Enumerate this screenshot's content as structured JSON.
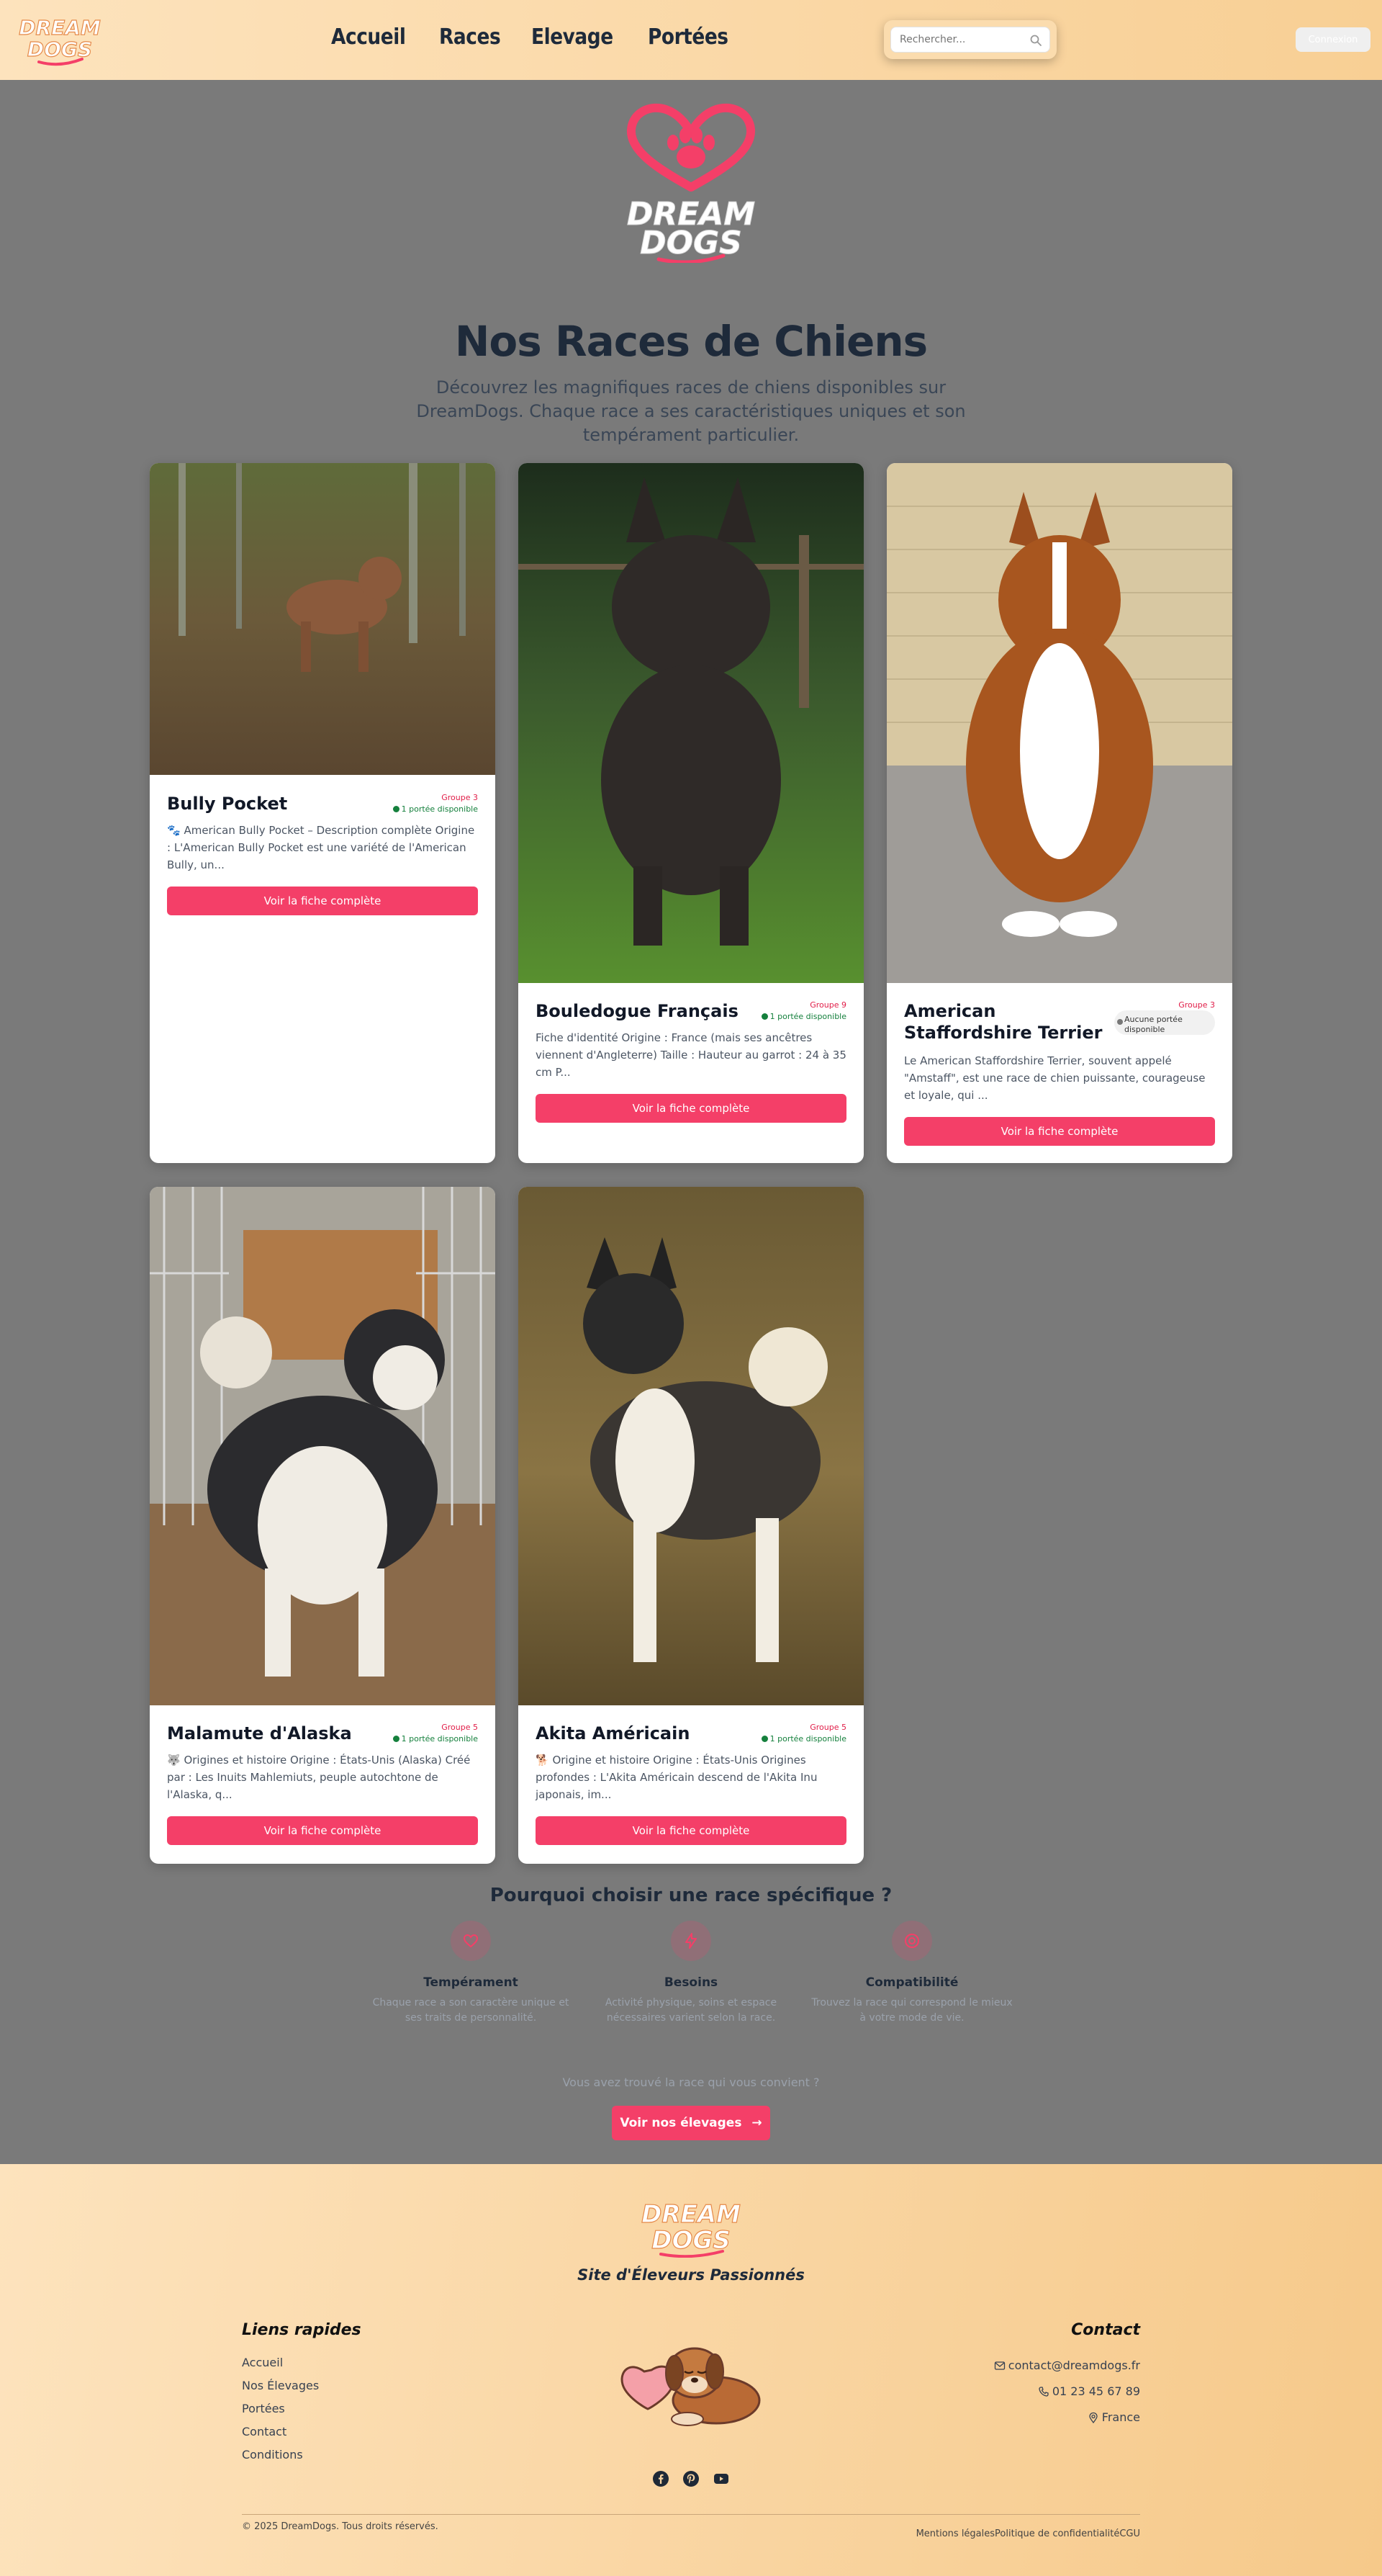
{
  "header": {
    "logo_line1": "DREAM",
    "logo_line2": "DOGS",
    "nav": [
      "Accueil",
      "Races",
      "Elevage",
      "Portées"
    ],
    "search_placeholder": "Rechercher...",
    "login_label": "Connexion"
  },
  "hero": {
    "logo_line1": "DREAM",
    "logo_line2": "DOGS",
    "title": "Nos Races de Chiens",
    "subtitle": "Découvrez les magnifiques races de chiens disponibles sur DreamDogs. Chaque race a ses caractéristiques uniques et son tempérament particulier."
  },
  "cards": [
    {
      "name": "Bully Pocket",
      "group": "Groupe 3",
      "availability": "1 portée disponible",
      "available": true,
      "description": "🐾 American Bully Pocket – Description complète Origine : L'American Bully Pocket est une variété de l'American Bully, un...",
      "cta": "Voir la fiche complète",
      "photo": "brown-dog-forest"
    },
    {
      "name": "Bouledogue Français",
      "group": "Groupe 9",
      "availability": "1 portée disponible",
      "available": true,
      "description": "Fiche d'identité Origine : France (mais ses ancêtres viennent d'Angleterre) Taille : Hauteur au garrot : 24 à 35 cm P...",
      "cta": "Voir la fiche complète",
      "photo": "black-french-bulldog"
    },
    {
      "name": "American Staffordshire Terrier",
      "group": "Groupe 3",
      "availability": "Aucune portée disponible",
      "available": false,
      "description": "Le American Staffordshire Terrier, souvent appelé \"Amstaff\", est une race de chien puissante, courageuse et loyale, qui ...",
      "cta": "Voir la fiche complète",
      "photo": "brown-white-amstaff"
    },
    {
      "name": "Malamute d'Alaska",
      "group": "Groupe 5",
      "availability": "1 portée disponible",
      "available": true,
      "description": "🐺 Origines et histoire Origine : États-Unis (Alaska) Créé par : Les Inuits Mahlemiuts, peuple autochtone de l'Alaska, q...",
      "cta": "Voir la fiche complète",
      "photo": "malamute-kennel"
    },
    {
      "name": "Akita Américain",
      "group": "Groupe 5",
      "availability": "1 portée disponible",
      "available": true,
      "description": "🐕 Origine et histoire Origine : États-Unis Origines profondes : L'Akita Américain descend de l'Akita Inu japonais, im...",
      "cta": "Voir la fiche complète",
      "photo": "akita-field"
    }
  ],
  "why": {
    "title": "Pourquoi choisir une race spécifique ?",
    "features": [
      {
        "icon": "heart-icon",
        "title": "Tempérament",
        "text": "Chaque race a son caractère unique et ses traits de personnalité."
      },
      {
        "icon": "lightning-icon",
        "title": "Besoins",
        "text": "Activité physique, soins et espace nécessaires varient selon la race."
      },
      {
        "icon": "target-icon",
        "title": "Compatibilité",
        "text": "Trouvez la race qui correspond le mieux à votre mode de vie."
      }
    ],
    "found_text": "Vous avez trouvé la race qui vous convient ?",
    "cta": "Voir nos élevages"
  },
  "footer": {
    "logo_line1": "DREAM",
    "logo_line2": "DOGS",
    "tagline": "Site d'Éleveurs Passionnés",
    "links_title": "Liens rapides",
    "links": [
      "Accueil",
      "Nos Élevages",
      "Portées",
      "Contact",
      "Conditions"
    ],
    "contact_title": "Contact",
    "email": "contact@dreamdogs.fr",
    "phone": "01 23 45 67 89",
    "location": "France",
    "copyright": "© 2025 DreamDogs. Tous droits réservés.",
    "legal": [
      "Mentions légales",
      "Politique de confidentialité",
      "CGU"
    ]
  },
  "colors": {
    "accent": "#f43f68",
    "header_bg_start": "#fde3bd",
    "header_bg_end": "#f8cf94",
    "page_bg": "#7a7a7a",
    "title": "#1e2a3a",
    "available": "#15803d"
  }
}
